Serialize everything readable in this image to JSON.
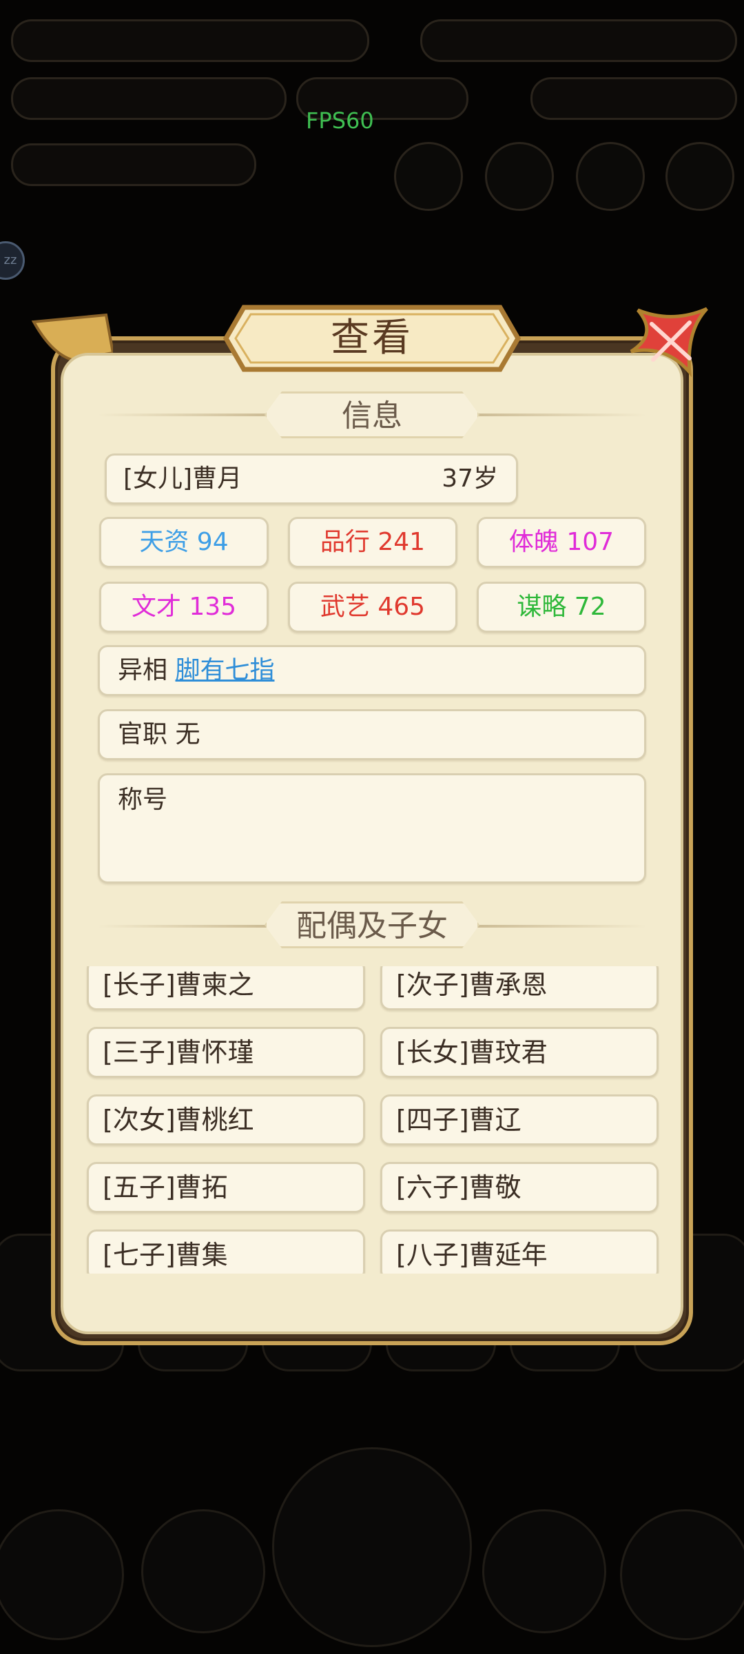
{
  "fps": "FPS60",
  "popup": {
    "title": "查看",
    "info_section": "信息",
    "person": {
      "name": "[女儿]曹月",
      "age": "37岁"
    },
    "stats": [
      {
        "label": "天资 94",
        "color": "#3d9ee6"
      },
      {
        "label": "品行 241",
        "color": "#e0392e"
      },
      {
        "label": "体魄 107",
        "color": "#e02cd8"
      },
      {
        "label": "文才 135",
        "color": "#e02cd8"
      },
      {
        "label": "武艺 465",
        "color": "#e0392e"
      },
      {
        "label": "谋略 72",
        "color": "#2fb83a"
      }
    ],
    "trait": {
      "label": "异相",
      "value": "脚有七指"
    },
    "office": "官职 无",
    "titles_label": "称号",
    "family_section": "配偶及子女",
    "children": [
      "[长子]曹柬之",
      "[次子]曹承恩",
      "[三子]曹怀瑾",
      "[长女]曹玟君",
      "[次女]曹桃红",
      "[四子]曹辽",
      "[五子]曹拓",
      "[六子]曹敬",
      "[七子]曹集",
      "[八子]曹延年"
    ]
  },
  "colors": {
    "panel": "#f3ebce",
    "frame": "#c9a357",
    "title_text": "#5a3a22",
    "close": "#e0413a"
  },
  "icons": [
    "close-icon",
    "sleep-icon"
  ]
}
